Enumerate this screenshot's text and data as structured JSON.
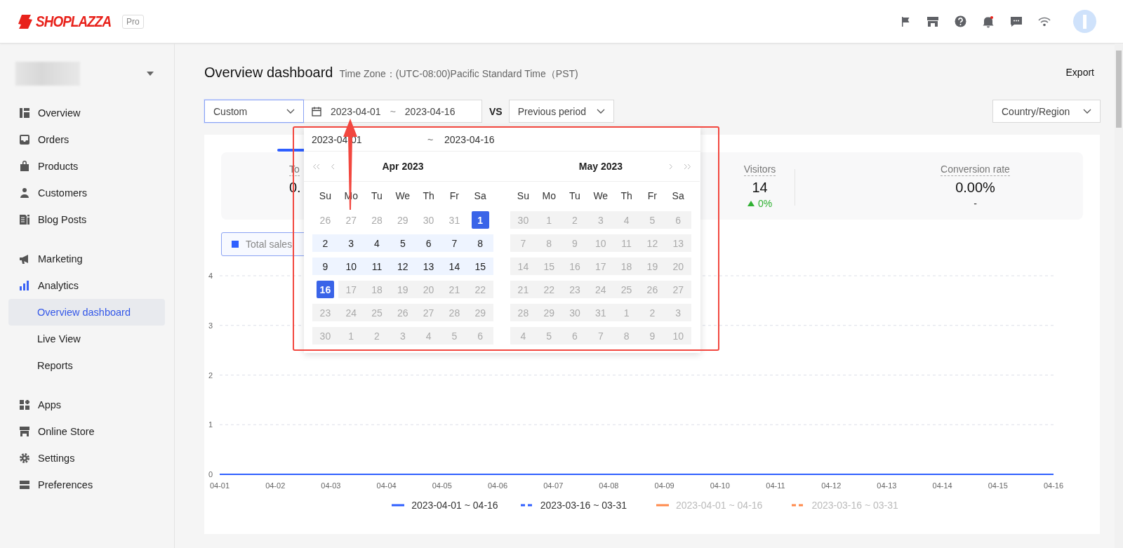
{
  "header": {
    "logo": "SHOPLAZZA",
    "plan_badge": "Pro"
  },
  "sidebar": {
    "groups": [
      {
        "items": [
          {
            "label": "Overview",
            "selected": false
          },
          {
            "label": "Orders",
            "selected": false
          },
          {
            "label": "Products",
            "selected": false
          },
          {
            "label": "Customers",
            "selected": false
          },
          {
            "label": "Blog Posts",
            "selected": false
          }
        ]
      },
      {
        "items": [
          {
            "label": "Marketing",
            "selected": false
          },
          {
            "label": "Analytics",
            "selected": false,
            "children": [
              {
                "label": "Overview dashboard",
                "selected": true
              },
              {
                "label": "Live View",
                "selected": false
              },
              {
                "label": "Reports",
                "selected": false
              }
            ]
          }
        ]
      },
      {
        "items": [
          {
            "label": "Apps",
            "selected": false
          },
          {
            "label": "Online Store",
            "selected": false
          },
          {
            "label": "Settings",
            "selected": false
          },
          {
            "label": "Preferences",
            "selected": false
          }
        ]
      }
    ]
  },
  "page": {
    "title": "Overview dashboard",
    "timezone": "Time Zone：(UTC-08:00)Pacific Standard Time（PST)",
    "export": "Export"
  },
  "filters": {
    "period": "Custom",
    "range_start": "2023-04-01",
    "range_sep": "~",
    "range_end": "2023-04-16",
    "vs": "VS",
    "compare": "Previous period",
    "region": "Country/Region"
  },
  "metrics": [
    {
      "label": "To",
      "value": "0."
    },
    {
      "label": "Visitors",
      "value": "14",
      "change": "0%"
    },
    {
      "label": "Conversion rate",
      "value": "0.00%",
      "change": "-"
    }
  ],
  "metric_toggle": "Total sales",
  "calendar": {
    "start": "2023-04-01",
    "sep": "~",
    "end": "2023-04-16",
    "months": [
      {
        "title": "Apr 2023",
        "weekdays": [
          "Su",
          "Mo",
          "Tu",
          "We",
          "Th",
          "Fr",
          "Sa"
        ],
        "weeks": [
          [
            {
              "d": "26",
              "kind": "outside"
            },
            {
              "d": "27",
              "kind": "outside"
            },
            {
              "d": "28",
              "kind": "outside"
            },
            {
              "d": "29",
              "kind": "outside"
            },
            {
              "d": "30",
              "kind": "outside"
            },
            {
              "d": "31",
              "kind": "outside"
            },
            {
              "d": "1",
              "kind": "selected"
            }
          ],
          [
            {
              "d": "2",
              "kind": "range"
            },
            {
              "d": "3",
              "kind": "range"
            },
            {
              "d": "4",
              "kind": "range"
            },
            {
              "d": "5",
              "kind": "range"
            },
            {
              "d": "6",
              "kind": "range"
            },
            {
              "d": "7",
              "kind": "range"
            },
            {
              "d": "8",
              "kind": "range"
            }
          ],
          [
            {
              "d": "9",
              "kind": "range"
            },
            {
              "d": "10",
              "kind": "range"
            },
            {
              "d": "11",
              "kind": "range"
            },
            {
              "d": "12",
              "kind": "range"
            },
            {
              "d": "13",
              "kind": "range"
            },
            {
              "d": "14",
              "kind": "range"
            },
            {
              "d": "15",
              "kind": "range"
            }
          ],
          [
            {
              "d": "16",
              "kind": "selected"
            },
            {
              "d": "17",
              "kind": "disabled"
            },
            {
              "d": "18",
              "kind": "disabled"
            },
            {
              "d": "19",
              "kind": "disabled"
            },
            {
              "d": "20",
              "kind": "disabled"
            },
            {
              "d": "21",
              "kind": "disabled"
            },
            {
              "d": "22",
              "kind": "disabled"
            }
          ],
          [
            {
              "d": "23",
              "kind": "disabled"
            },
            {
              "d": "24",
              "kind": "disabled"
            },
            {
              "d": "25",
              "kind": "disabled"
            },
            {
              "d": "26",
              "kind": "disabled"
            },
            {
              "d": "27",
              "kind": "disabled"
            },
            {
              "d": "28",
              "kind": "disabled"
            },
            {
              "d": "29",
              "kind": "disabled"
            }
          ],
          [
            {
              "d": "30",
              "kind": "disabled"
            },
            {
              "d": "1",
              "kind": "disabled"
            },
            {
              "d": "2",
              "kind": "disabled"
            },
            {
              "d": "3",
              "kind": "disabled"
            },
            {
              "d": "4",
              "kind": "disabled"
            },
            {
              "d": "5",
              "kind": "disabled"
            },
            {
              "d": "6",
              "kind": "disabled"
            }
          ]
        ]
      },
      {
        "title": "May 2023",
        "weekdays": [
          "Su",
          "Mo",
          "Tu",
          "We",
          "Th",
          "Fr",
          "Sa"
        ],
        "weeks": [
          [
            {
              "d": "30",
              "kind": "disabled"
            },
            {
              "d": "1",
              "kind": "disabled"
            },
            {
              "d": "2",
              "kind": "disabled"
            },
            {
              "d": "3",
              "kind": "disabled"
            },
            {
              "d": "4",
              "kind": "disabled"
            },
            {
              "d": "5",
              "kind": "disabled"
            },
            {
              "d": "6",
              "kind": "disabled"
            }
          ],
          [
            {
              "d": "7",
              "kind": "disabled"
            },
            {
              "d": "8",
              "kind": "disabled"
            },
            {
              "d": "9",
              "kind": "disabled"
            },
            {
              "d": "10",
              "kind": "disabled"
            },
            {
              "d": "11",
              "kind": "disabled"
            },
            {
              "d": "12",
              "kind": "disabled"
            },
            {
              "d": "13",
              "kind": "disabled"
            }
          ],
          [
            {
              "d": "14",
              "kind": "disabled"
            },
            {
              "d": "15",
              "kind": "disabled"
            },
            {
              "d": "16",
              "kind": "disabled"
            },
            {
              "d": "17",
              "kind": "disabled"
            },
            {
              "d": "18",
              "kind": "disabled"
            },
            {
              "d": "19",
              "kind": "disabled"
            },
            {
              "d": "20",
              "kind": "disabled"
            }
          ],
          [
            {
              "d": "21",
              "kind": "disabled"
            },
            {
              "d": "22",
              "kind": "disabled"
            },
            {
              "d": "23",
              "kind": "disabled"
            },
            {
              "d": "24",
              "kind": "disabled"
            },
            {
              "d": "25",
              "kind": "disabled"
            },
            {
              "d": "26",
              "kind": "disabled"
            },
            {
              "d": "27",
              "kind": "disabled"
            }
          ],
          [
            {
              "d": "28",
              "kind": "disabled"
            },
            {
              "d": "29",
              "kind": "disabled"
            },
            {
              "d": "30",
              "kind": "disabled"
            },
            {
              "d": "31",
              "kind": "disabled"
            },
            {
              "d": "1",
              "kind": "disabled"
            },
            {
              "d": "2",
              "kind": "disabled"
            },
            {
              "d": "3",
              "kind": "disabled"
            }
          ],
          [
            {
              "d": "4",
              "kind": "disabled"
            },
            {
              "d": "5",
              "kind": "disabled"
            },
            {
              "d": "6",
              "kind": "disabled"
            },
            {
              "d": "7",
              "kind": "disabled"
            },
            {
              "d": "8",
              "kind": "disabled"
            },
            {
              "d": "9",
              "kind": "disabled"
            },
            {
              "d": "10",
              "kind": "disabled"
            }
          ]
        ]
      }
    ]
  },
  "chart": {
    "chart_data": {
      "type": "line",
      "categories": [
        "04-01",
        "04-02",
        "04-03",
        "04-04",
        "04-05",
        "04-06",
        "04-07",
        "04-08",
        "04-09",
        "04-10",
        "04-11",
        "04-12",
        "04-13",
        "04-14",
        "04-15",
        "04-16"
      ],
      "ylim": [
        0,
        4
      ],
      "yticks": [
        0,
        1,
        2,
        3,
        4
      ],
      "grid": true,
      "series": [
        {
          "name": "2023-04-01 ~ 04-16",
          "color": "#2f5fff",
          "line_style": "solid",
          "values": [
            0,
            0,
            0,
            0,
            0,
            0,
            0,
            0,
            0,
            0,
            0,
            0,
            0,
            0,
            0,
            0
          ]
        },
        {
          "name": "2023-03-16 ~ 03-31",
          "color": "#2f5fff",
          "line_style": "dashed",
          "values": [
            0,
            0,
            0,
            0,
            0,
            0,
            0,
            0,
            0,
            0,
            0,
            0,
            0,
            0,
            0,
            0
          ]
        }
      ]
    },
    "hidden_series": [
      {
        "label": "2023-04-01 ~ 04-16",
        "color": "#ff8a4c",
        "kind": "solid"
      },
      {
        "label": "2023-03-16 ~ 03-31",
        "color": "#ff8a4c",
        "kind": "dashed"
      }
    ]
  }
}
